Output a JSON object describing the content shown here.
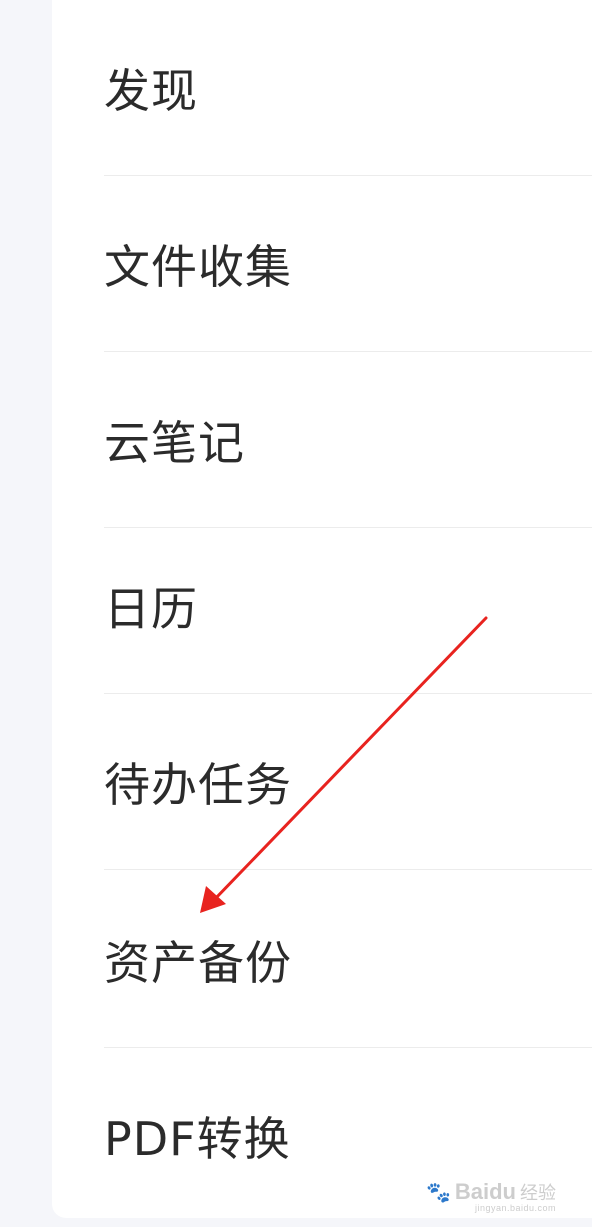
{
  "menu": {
    "items": [
      {
        "label": "发现"
      },
      {
        "label": "文件收集"
      },
      {
        "label": "云笔记"
      },
      {
        "label": "日历"
      },
      {
        "label": "待办任务"
      },
      {
        "label": "资产备份"
      },
      {
        "label": "PDF转换"
      }
    ]
  },
  "annotation": {
    "arrow_color": "#e8231f",
    "points_to": "资产备份"
  },
  "watermark": {
    "main": "Baidu",
    "sub": "经验",
    "url": "jingyan.baidu.com"
  }
}
